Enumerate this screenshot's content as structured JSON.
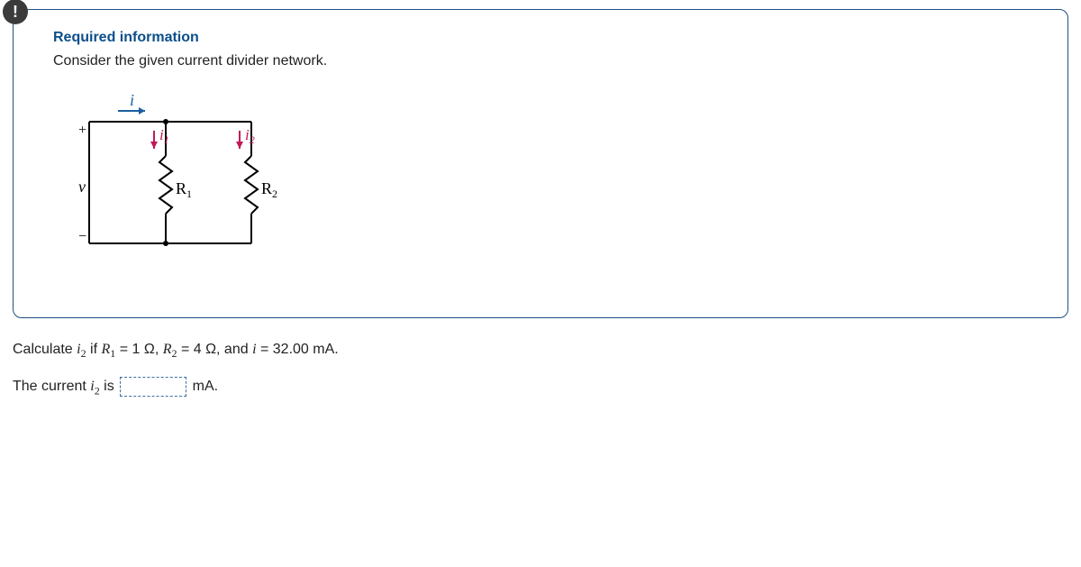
{
  "alert_symbol": "!",
  "heading": "Required information",
  "intro": "Consider the given current divider network.",
  "circuit": {
    "i": "i",
    "i1": "i",
    "i1_sub": "1",
    "i2": "i",
    "i2_sub": "2",
    "v": "v",
    "plus": "+",
    "minus": "−",
    "R1": "R",
    "R1_sub": "1",
    "R2": "R",
    "R2_sub": "2"
  },
  "question": {
    "pre": "Calculate ",
    "var": "i",
    "var_sub": "2",
    "mid1": " if ",
    "R1": "R",
    "R1_sub": "1",
    "eq1": " = 1 Ω, ",
    "R2": "R",
    "R2_sub": "2",
    "eq2": " = 4 Ω, and ",
    "ivar": "i",
    "eq3": " = 32.00 mA."
  },
  "answer": {
    "pre": "The current ",
    "var": "i",
    "var_sub": "2",
    "mid": " is",
    "unit": "mA."
  }
}
